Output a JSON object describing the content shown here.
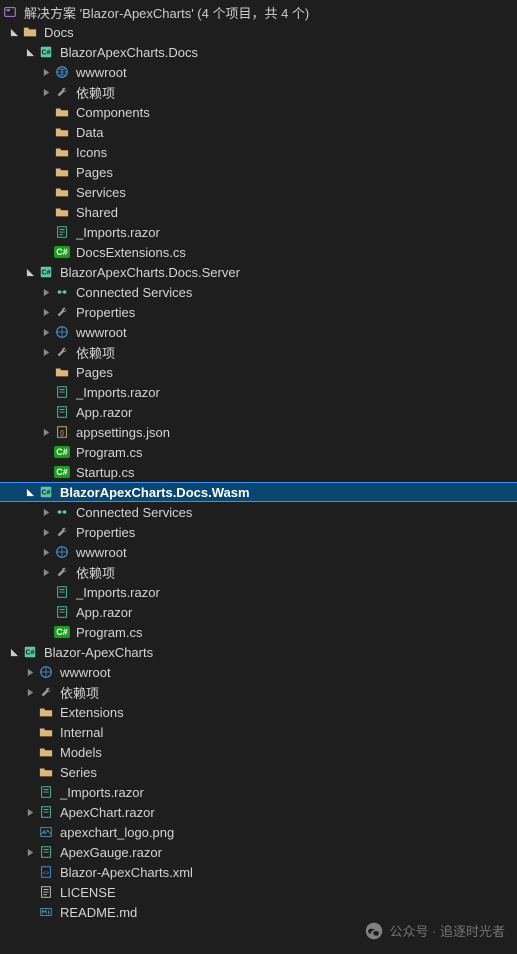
{
  "solution": {
    "header": "解决方案 'Blazor-ApexCharts' (4 个项目，共 4 个)"
  },
  "nodes": {
    "docs_folder": "Docs",
    "docs_proj": "BlazorApexCharts.Docs",
    "wwwroot": "wwwroot",
    "deps": "依赖项",
    "components": "Components",
    "data": "Data",
    "icons": "Icons",
    "pages": "Pages",
    "services": "Services",
    "shared": "Shared",
    "imports": "_Imports.razor",
    "docs_ext": "DocsExtensions.cs",
    "server_proj": "BlazorApexCharts.Docs.Server",
    "connected": "Connected Services",
    "properties": "Properties",
    "app_razor": "App.razor",
    "appsettings": "appsettings.json",
    "program": "Program.cs",
    "startup": "Startup.cs",
    "wasm_proj": "BlazorApexCharts.Docs.Wasm",
    "blazor_apex": "Blazor-ApexCharts",
    "extensions": "Extensions",
    "internal": "Internal",
    "models": "Models",
    "series": "Series",
    "apexchart_razor": "ApexChart.razor",
    "apexchart_logo": "apexchart_logo.png",
    "apexgauge": "ApexGauge.razor",
    "blazor_xml": "Blazor-ApexCharts.xml",
    "license": "LICENSE",
    "readme": "README.md"
  },
  "watermark": {
    "text": "公众号 · 追逐时光者"
  }
}
